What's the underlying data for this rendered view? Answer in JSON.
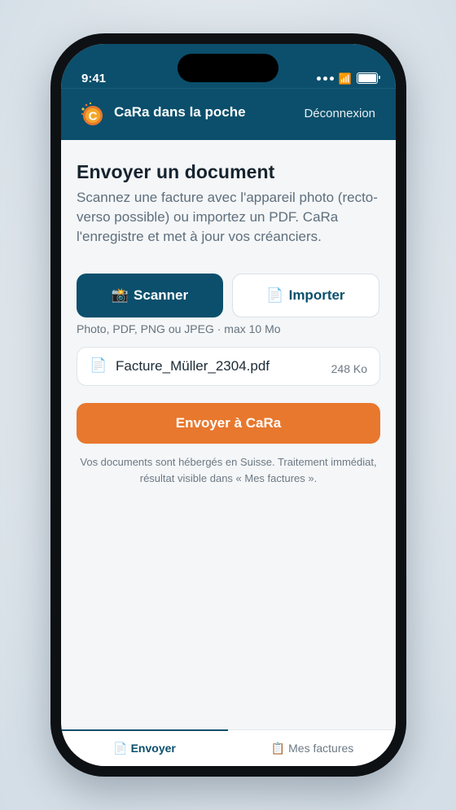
{
  "status_bar": {
    "time": "9:41"
  },
  "header": {
    "title": "CaRa dans la poche",
    "logout_label": "Déconnexion"
  },
  "main": {
    "heading": "Envoyer un document",
    "description": "Scannez une facture avec l'appareil photo (recto-verso possible) ou importez un PDF. CaRa l'enregistre et met à jour vos créanciers.",
    "scan_button": {
      "icon": "📸",
      "label": "Scanner"
    },
    "import_button": {
      "icon": "📄",
      "label": "Importer"
    },
    "hint": "Photo, PDF, PNG ou JPEG · max 10 Mo",
    "file": {
      "icon": "📄",
      "name": "Facture_Müller_2304.pdf",
      "size": "248 Ko"
    },
    "send_button_label": "Envoyer à CaRa",
    "footnote": "Vos documents sont hébergés en Suisse. Traitement immédiat, résultat visible dans « Mes factures »."
  },
  "tabs": [
    {
      "icon": "📄",
      "label": "Envoyer",
      "active": true
    },
    {
      "icon": "📋",
      "label": "Mes factures",
      "active": false
    }
  ],
  "colors": {
    "primary": "#0b4f6c",
    "accent": "#e8782e",
    "background": "#f4f6f8"
  }
}
